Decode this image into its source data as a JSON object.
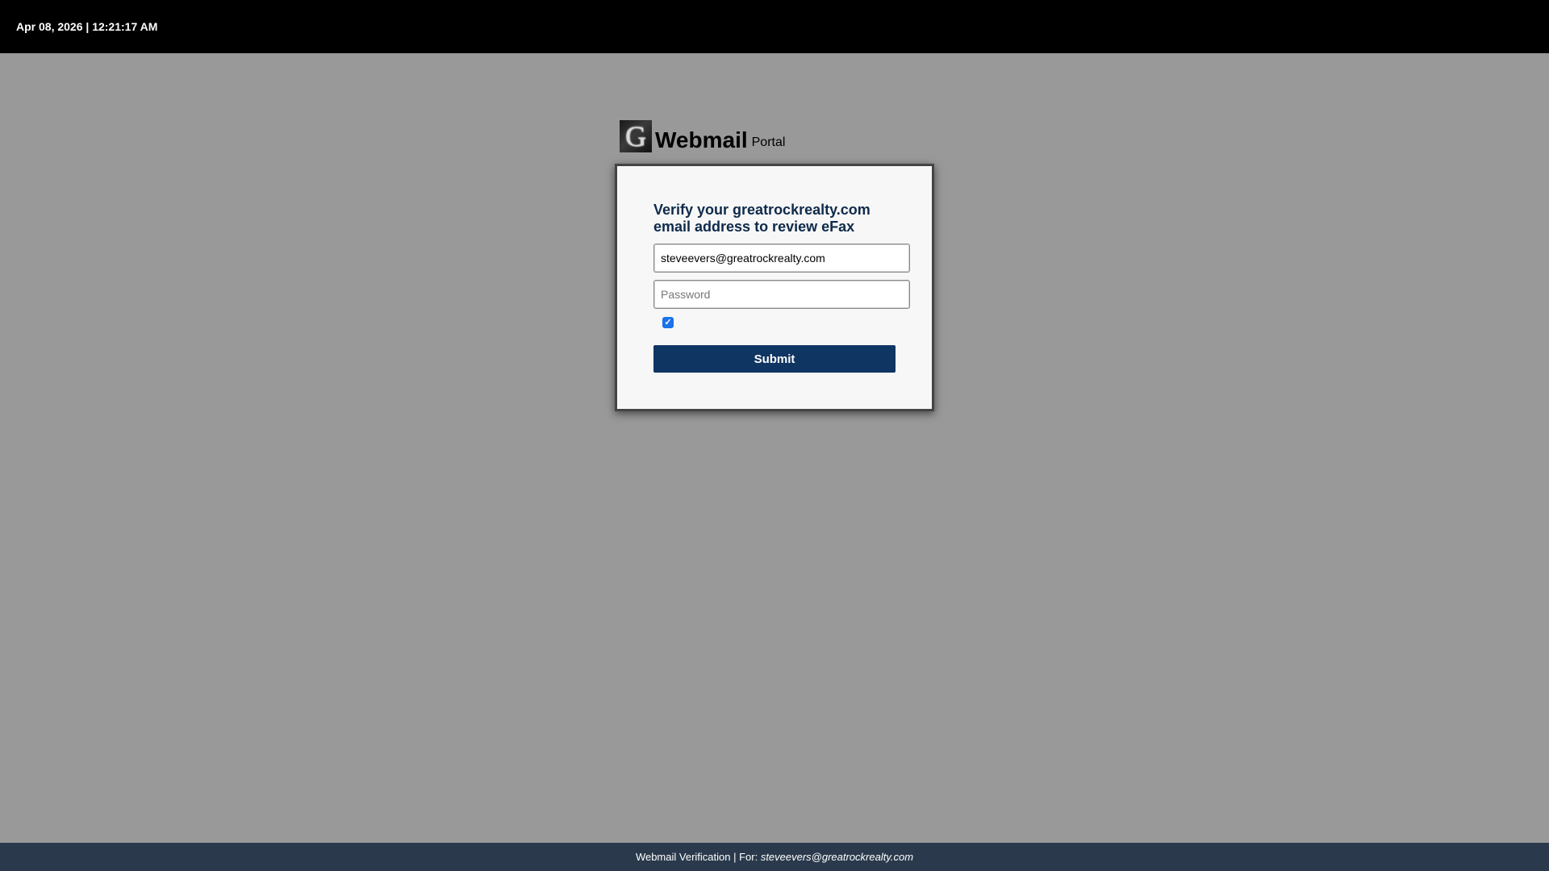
{
  "header": {
    "datetime": "Apr 08, 2026 | 12:21:17 AM"
  },
  "brand": {
    "logo_letter": "G",
    "logo_icon": "g-logo-icon",
    "name": "Webmail",
    "suffix": "Portal"
  },
  "card": {
    "heading": "Verify your greatrockrealty.com email address to review eFax",
    "email_value": "steveevers@greatrockrealty.com",
    "password_placeholder": "Password",
    "password_value": "",
    "remember_checked": true,
    "submit_label": "Submit"
  },
  "footer": {
    "prefix": "Webmail Verification | For:",
    "email": "steveevers@greatrockrealty.com"
  },
  "colors": {
    "page_background": "#999999",
    "topbar": "#000000",
    "submit_button": "#0f3562",
    "footer": "#2a3a4c",
    "heading_text": "#0f2a4a",
    "checkbox": "#1a73e8"
  }
}
